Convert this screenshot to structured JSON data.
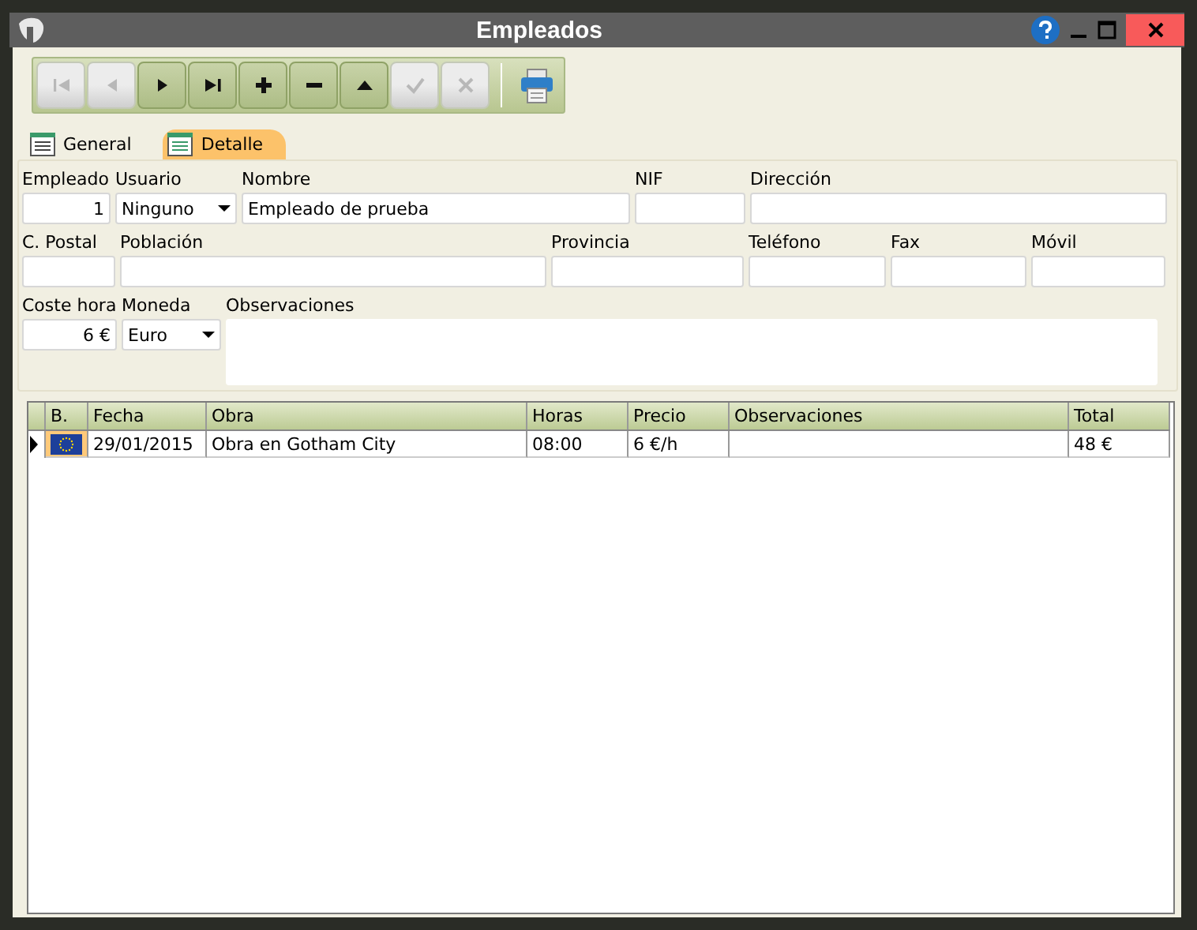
{
  "window": {
    "title": "Empleados"
  },
  "toolbar": {
    "buttons": [
      {
        "kind": "first",
        "disabled": true
      },
      {
        "kind": "prev",
        "disabled": true
      },
      {
        "kind": "next",
        "disabled": false
      },
      {
        "kind": "last",
        "disabled": false
      },
      {
        "kind": "add",
        "disabled": false
      },
      {
        "kind": "remove",
        "disabled": false
      },
      {
        "kind": "up",
        "disabled": false
      },
      {
        "kind": "confirm",
        "disabled": true
      },
      {
        "kind": "cancel",
        "disabled": true
      }
    ]
  },
  "tabs": [
    {
      "label": "General",
      "selected": false
    },
    {
      "label": "Detalle",
      "selected": true
    }
  ],
  "form": {
    "lines": [
      {
        "fields": [
          {
            "label": "Empleado",
            "kind": "number",
            "value": "1"
          },
          {
            "label": "Usuario",
            "kind": "select",
            "value": "Ninguno"
          },
          {
            "label": "Nombre",
            "kind": "text",
            "value": "Empleado de prueba"
          },
          {
            "label": "NIF",
            "kind": "text"
          },
          {
            "label": "Dirección",
            "kind": "text"
          }
        ]
      },
      {
        "fields": [
          {
            "label": "C. Postal",
            "kind": "text"
          },
          {
            "label": "Población",
            "kind": "text"
          },
          {
            "label": "Provincia",
            "kind": "text"
          },
          {
            "label": "Teléfono",
            "kind": "text"
          },
          {
            "label": "Fax",
            "kind": "text"
          },
          {
            "label": "Móvil",
            "kind": "text"
          }
        ]
      },
      {
        "fields": [
          {
            "label": "Coste hora",
            "kind": "number",
            "value": "6 €"
          },
          {
            "label": "Moneda",
            "kind": "select",
            "value": "Euro"
          },
          {
            "label": "Observaciones",
            "kind": "memo"
          }
        ]
      }
    ]
  },
  "grid": {
    "columns": [
      "B.",
      "Fecha",
      "Obra",
      "Horas",
      "Precio",
      "Observaciones",
      "Total"
    ],
    "rows": [
      {
        "current": true,
        "cells": [
          {
            "kind": "flag"
          },
          {
            "text": "29/01/2015"
          },
          {
            "text": "Obra en Gotham City"
          },
          {
            "text": "08:00"
          },
          {
            "text": "6 €/h"
          },
          {
            "kind": "empty"
          },
          {
            "text": "48 €"
          }
        ]
      }
    ]
  }
}
